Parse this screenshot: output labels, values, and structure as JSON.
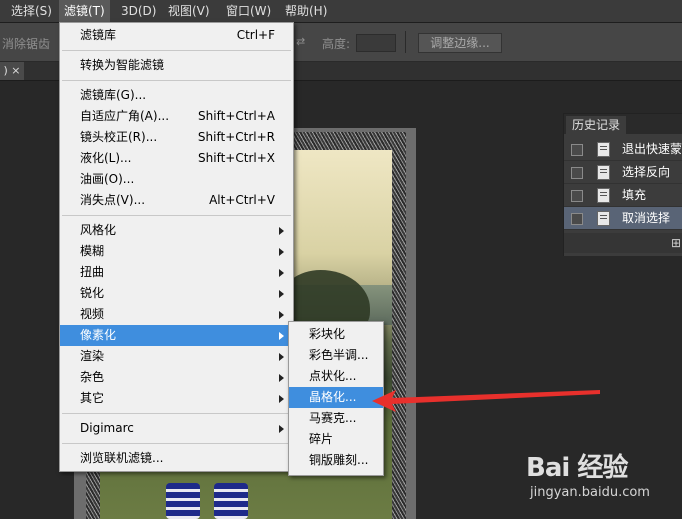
{
  "menubar": {
    "items": [
      "选择(S)",
      "滤镜(T)",
      "3D(D)",
      "视图(V)",
      "窗口(W)",
      "帮助(H)"
    ],
    "active_index": 1
  },
  "options_bar": {
    "antialias_label": "消除锯齿",
    "height_label": "高度:",
    "refine_edge_button": "调整边缘..."
  },
  "filter_menu": {
    "items": [
      {
        "label": "滤镜库",
        "shortcut": "Ctrl+F"
      },
      {
        "label": "转换为智能滤镜"
      },
      {
        "label": "滤镜库(G)..."
      },
      {
        "label": "自适应广角(A)...",
        "shortcut": "Shift+Ctrl+A"
      },
      {
        "label": "镜头校正(R)...",
        "shortcut": "Shift+Ctrl+R"
      },
      {
        "label": "液化(L)...",
        "shortcut": "Shift+Ctrl+X"
      },
      {
        "label": "油画(O)..."
      },
      {
        "label": "消失点(V)...",
        "shortcut": "Alt+Ctrl+V"
      },
      {
        "label": "风格化",
        "submenu": true
      },
      {
        "label": "模糊",
        "submenu": true
      },
      {
        "label": "扭曲",
        "submenu": true
      },
      {
        "label": "锐化",
        "submenu": true
      },
      {
        "label": "视频",
        "submenu": true
      },
      {
        "label": "像素化",
        "submenu": true,
        "highlighted": true
      },
      {
        "label": "渲染",
        "submenu": true
      },
      {
        "label": "杂色",
        "submenu": true
      },
      {
        "label": "其它",
        "submenu": true
      },
      {
        "label": "Digimarc",
        "submenu": true
      },
      {
        "label": "浏览联机滤镜..."
      }
    ]
  },
  "pixelate_submenu": {
    "items": [
      {
        "label": "彩块化"
      },
      {
        "label": "彩色半调..."
      },
      {
        "label": "点状化..."
      },
      {
        "label": "晶格化...",
        "highlighted": true
      },
      {
        "label": "马赛克..."
      },
      {
        "label": "碎片"
      },
      {
        "label": "铜版雕刻..."
      }
    ]
  },
  "history_panel": {
    "tab_label": "历史记录",
    "items": [
      {
        "label": "退出快速蒙"
      },
      {
        "label": "选择反向"
      },
      {
        "label": "填充"
      },
      {
        "label": "取消选择",
        "selected": true
      }
    ]
  },
  "watermark": {
    "brand": "Bai 经验",
    "url": "jingyan.baidu.com"
  },
  "colors": {
    "highlight": "#3f8ede",
    "annotation_arrow": "#e8302c",
    "history_selected": "#596476"
  }
}
